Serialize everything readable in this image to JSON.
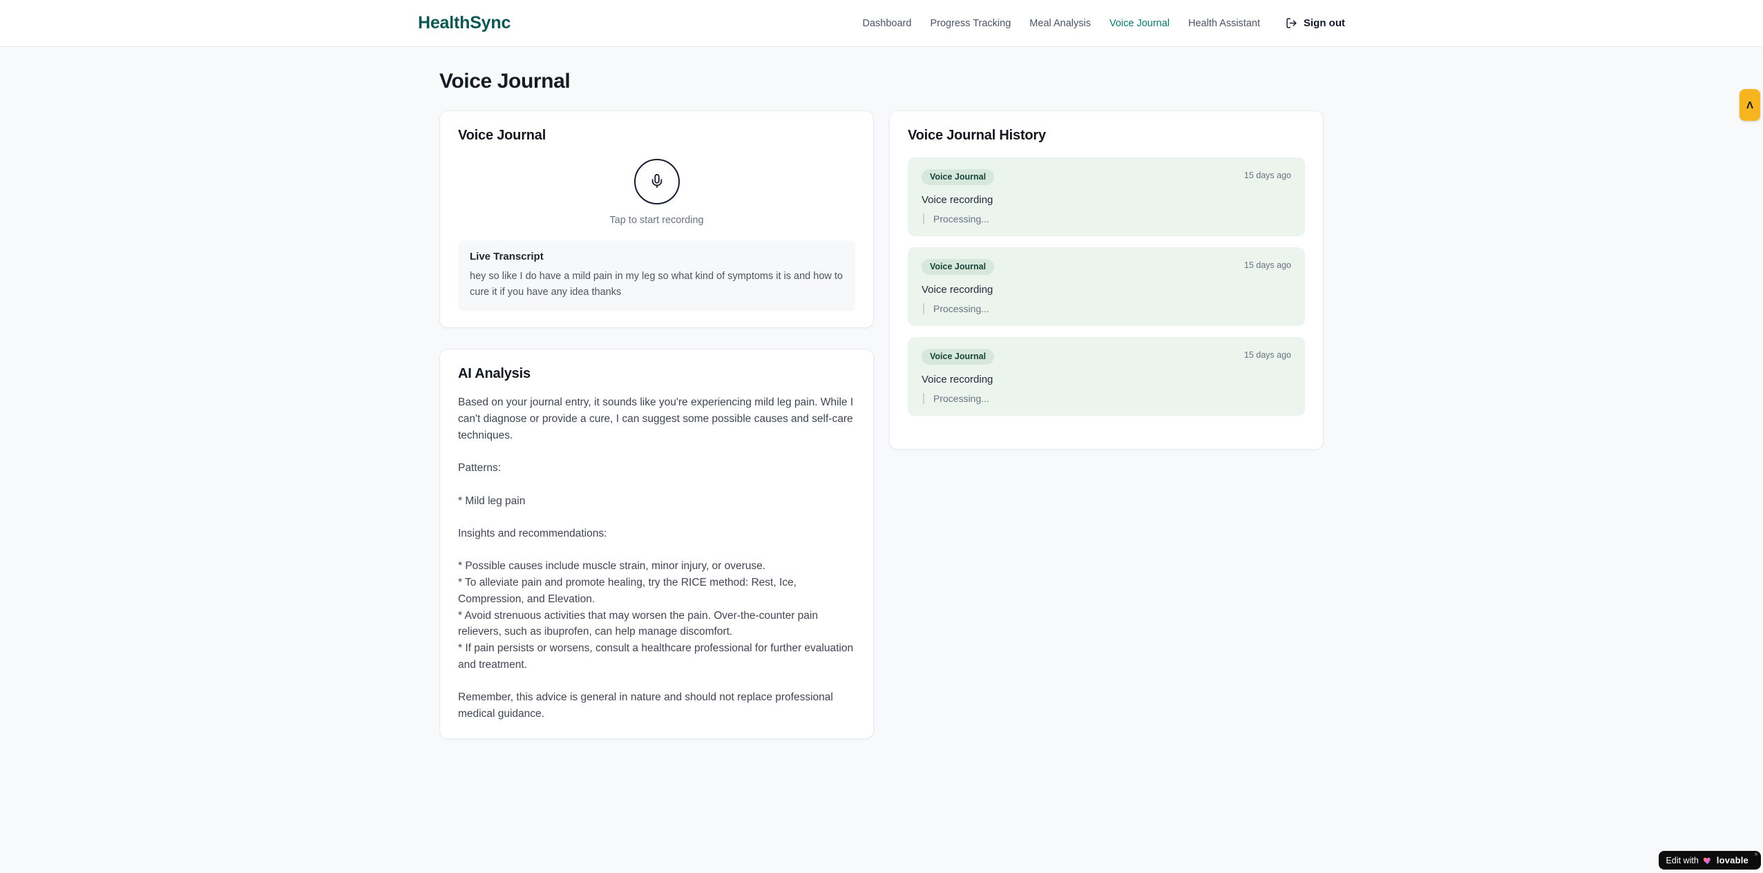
{
  "brand": {
    "name": "HealthSync"
  },
  "nav": {
    "items": [
      {
        "label": "Dashboard"
      },
      {
        "label": "Progress Tracking"
      },
      {
        "label": "Meal Analysis"
      },
      {
        "label": "Voice Journal",
        "active": true
      },
      {
        "label": "Health Assistant"
      }
    ],
    "sign_out_label": "Sign out"
  },
  "page": {
    "title": "Voice Journal"
  },
  "recorder": {
    "card_title": "Voice Journal",
    "tap_hint": "Tap to start recording",
    "transcript_title": "Live Transcript",
    "transcript_text": "hey so like I do have a mild pain in my leg so what kind of symptoms it is and how to cure it if you have any idea thanks"
  },
  "analysis": {
    "card_title": "AI Analysis",
    "body": "Based on your journal entry, it sounds like you're experiencing mild leg pain. While I can't diagnose or provide a cure, I can suggest some possible causes and self-care techniques.\n\nPatterns:\n\n* Mild leg pain\n\nInsights and recommendations:\n\n* Possible causes include muscle strain, minor injury, or overuse.\n* To alleviate pain and promote healing, try the RICE method: Rest, Ice, Compression, and Elevation.\n* Avoid strenuous activities that may worsen the pain. Over-the-counter pain relievers, such as ibuprofen, can help manage discomfort.\n* If pain persists or worsens, consult a healthcare professional for further evaluation and treatment.\n\nRemember, this advice is general in nature and should not replace professional medical guidance."
  },
  "history": {
    "card_title": "Voice Journal History",
    "entries": [
      {
        "badge": "Voice Journal",
        "time": "15 days ago",
        "title": "Voice recording",
        "status": "Processing..."
      },
      {
        "badge": "Voice Journal",
        "time": "15 days ago",
        "title": "Voice recording",
        "status": "Processing..."
      },
      {
        "badge": "Voice Journal",
        "time": "15 days ago",
        "title": "Voice recording",
        "status": "Processing..."
      }
    ]
  },
  "widgets": {
    "side_tab_glyph": "Λ",
    "edit_badge": {
      "prefix": "Edit with",
      "brand": "lovable",
      "close": "×"
    }
  },
  "colors": {
    "brand_teal": "#0d5752",
    "nav_active_teal": "#0f766e",
    "history_entry_bg": "#ecf4ee",
    "badge_bg": "#d8e7dc",
    "badge_text": "#16453a",
    "side_tab_amber": "#f6b51f",
    "page_bg": "#f8f9fb"
  }
}
